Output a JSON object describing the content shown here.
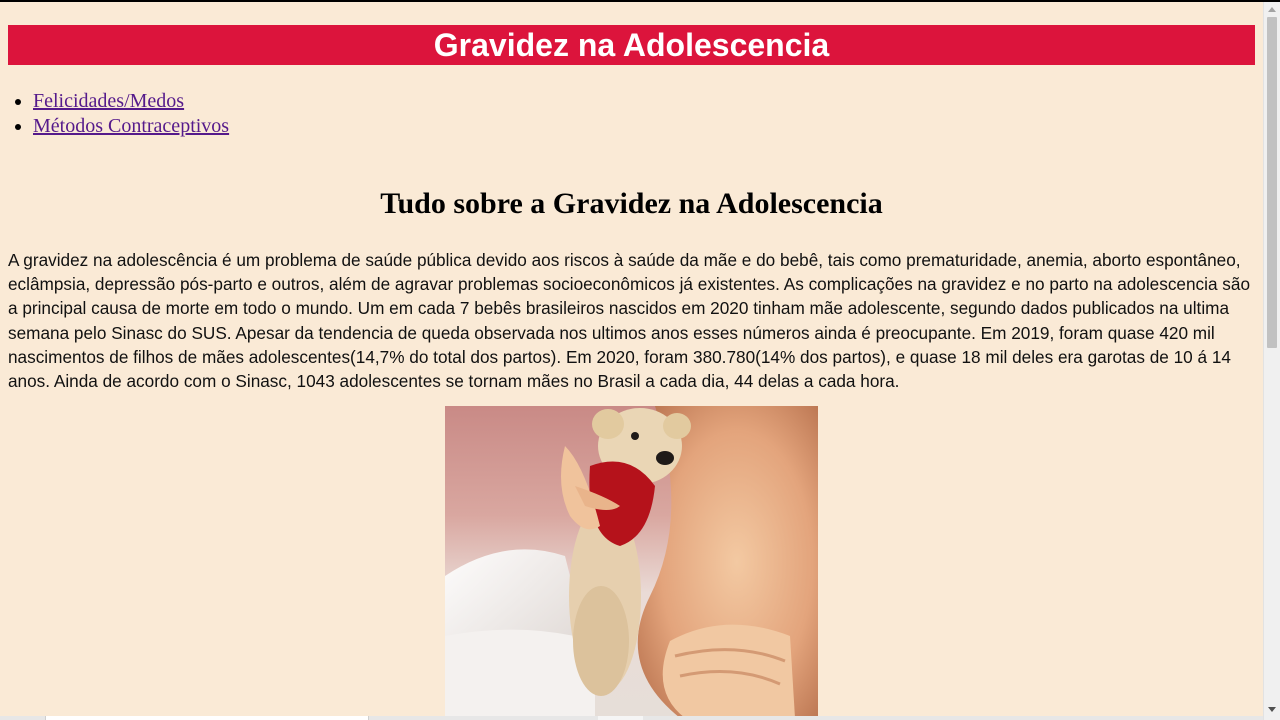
{
  "header": {
    "title": "Gravidez na Adolescencia"
  },
  "nav": {
    "items": [
      {
        "label": "Felicidades/Medos"
      },
      {
        "label": "Métodos Contraceptivos"
      }
    ]
  },
  "main": {
    "heading": "Tudo sobre a Gravidez na Adolescencia",
    "paragraph": "A gravidez na adolescência é um problema de saúde pública devido aos riscos à saúde da mãe e do bebê, tais como prematuridade, anemia, aborto espontâneo, eclâmpsia, depressão pós-parto e outros, além de agravar problemas socioeconômicos já existentes. As complicações na gravidez e no parto na adolescencia são a principal causa de morte em todo o mundo. Um em cada 7 bebês brasileiros nascidos em 2020 tinham mãe adolescente, segundo dados publicados na ultima semana pelo Sinasc do SUS. Apesar da tendencia de queda observada nos ultimos anos esses números ainda é preocupante. Em 2019, foram quase 420 mil nascimentos de filhos de mães adolescentes(14,7% do total dos partos). Em 2020, foram 380.780(14% dos partos), e quase 18 mil deles era garotas de 10 á 14 anos. Ainda de acordo com o Sinasc, 1043 adolescentes se tornam mães no Brasil a cada dia, 44 delas a cada hora."
  },
  "colors": {
    "page_background": "#faead6",
    "header_background": "#dc143c",
    "header_text": "#ffffff",
    "link": "#551a8b"
  },
  "icons": {
    "scroll_up": "scroll-up-arrow-icon",
    "scroll_down": "scroll-down-arrow-icon"
  }
}
